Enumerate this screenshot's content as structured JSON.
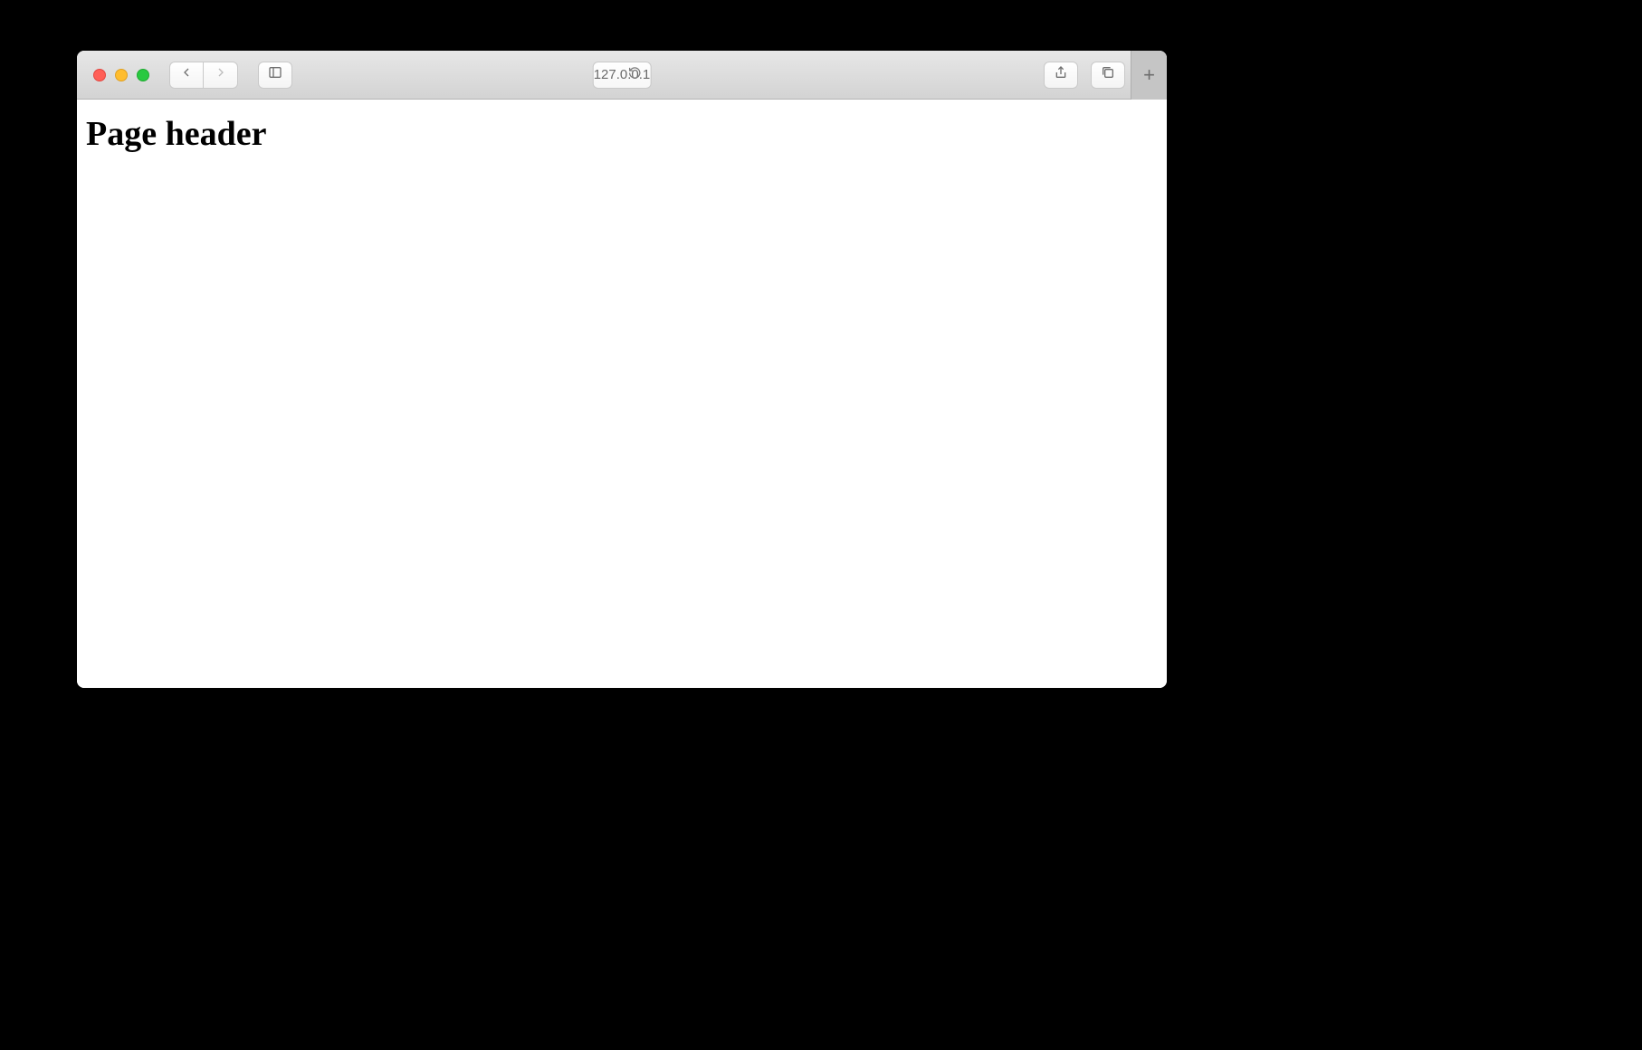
{
  "browser": {
    "address": "127.0.0.1"
  },
  "page": {
    "header": "Page header"
  }
}
